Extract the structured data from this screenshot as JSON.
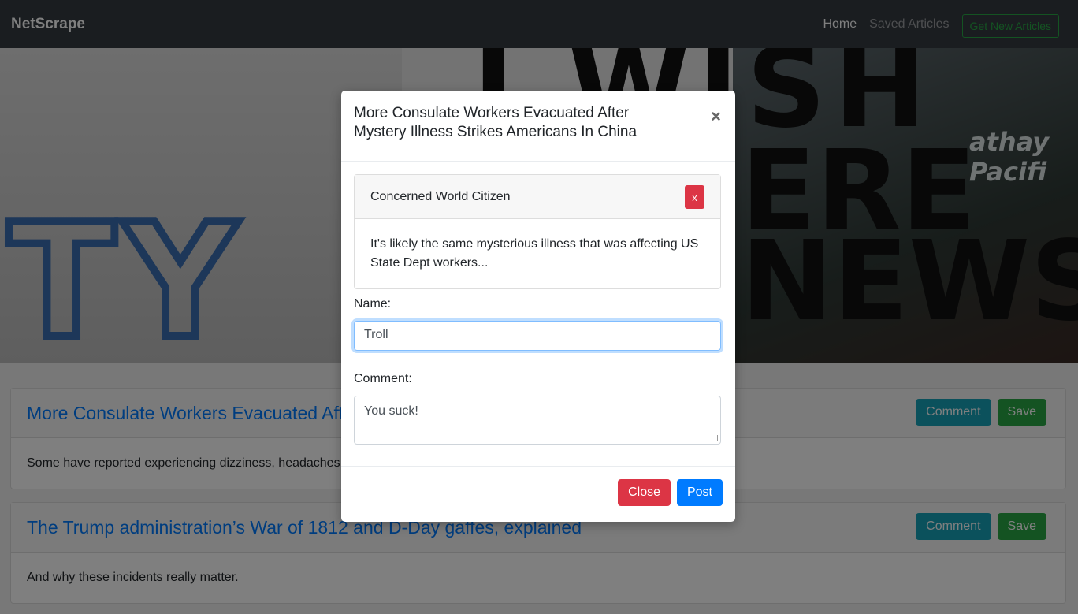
{
  "navbar": {
    "brand": "NetScrape",
    "links": [
      "Home",
      "Saved Articles"
    ],
    "action": "Get New Articles"
  },
  "articles": [
    {
      "title": "More Consulate Workers Evacuated After Mystery Illness Strikes Americans In China",
      "summary": "Some have reported experiencing dizziness, headaches, and more."
    },
    {
      "title": "The Trump administration’s War of 1812 and D-Day gaffes, explained",
      "summary": "And why these incidents really matter."
    }
  ],
  "article_actions": {
    "comment": "Comment",
    "save": "Save"
  },
  "modal": {
    "title": "More Consulate Workers Evacuated After Mystery Illness Strikes Americans In China",
    "close_symbol": "×",
    "comment": {
      "author": "Concerned World Citizen",
      "delete_label": "x",
      "text": "It's likely the same mysterious illness that was affecting US State Dept workers..."
    },
    "name_label": "Name:",
    "name_value": "Troll",
    "comment_label": "Comment:",
    "comment_value": "You suck!",
    "buttons": {
      "close": "Close",
      "post": "Post"
    }
  }
}
